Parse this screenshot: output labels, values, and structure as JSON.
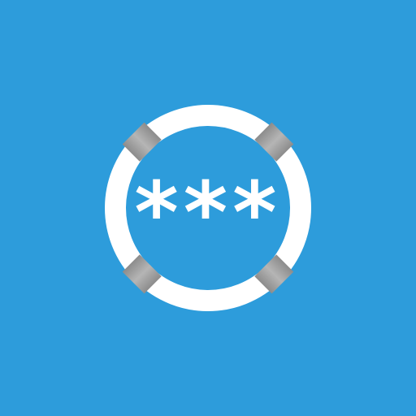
{
  "icon": {
    "name": "lifebuoy-password-icon",
    "background_color": "#2D9CDB",
    "ring_color": "#FFFFFF",
    "band_color": "#8C8C8C",
    "band_highlight_color": "#B5B5B5",
    "mask_color": "#FFFFFF",
    "mask_text": "***"
  }
}
